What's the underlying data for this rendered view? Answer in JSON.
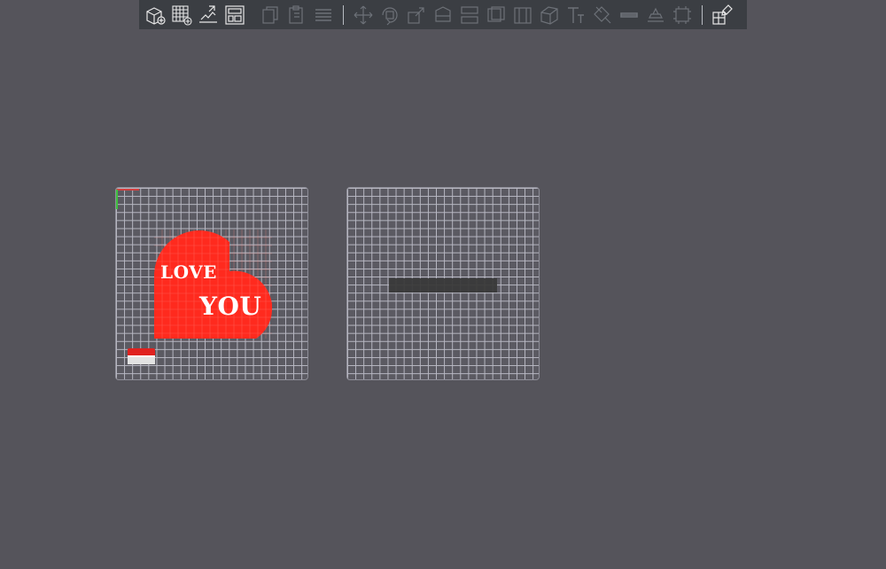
{
  "toolbar": {
    "groups": [
      [
        "add-object-icon",
        "add-plate-icon",
        "import-icon",
        "arrange-icon"
      ],
      [
        "copy-icon",
        "paste-icon",
        "layers-icon"
      ],
      [
        "move-icon",
        "rotate-icon",
        "scale-icon",
        "cut-icon",
        "split-objects-icon",
        "split-parts-icon",
        "boolean-icon",
        "emboss-icon",
        "text-icon",
        "support-paint-icon",
        "seam-paint-icon",
        "variable-layer-icon",
        "measure-icon",
        "assembly-icon"
      ],
      [
        "ai-assist-icon"
      ]
    ]
  },
  "plate_1": {
    "model_text_line1": "LOVE",
    "model_text_line2": "YOU",
    "model_color": "#ff2a1e"
  },
  "plate_2": {
    "model_color": "#3a3a3a"
  }
}
